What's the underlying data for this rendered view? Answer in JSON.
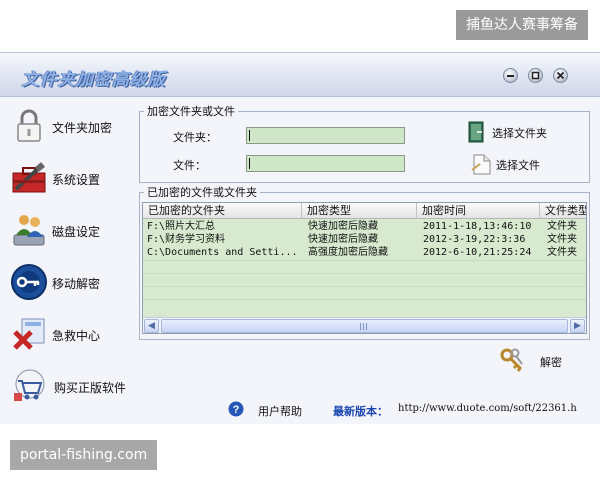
{
  "watermark_top": "捕鱼达人赛事筹备",
  "watermark_bottom": "portal-fishing.com",
  "window": {
    "title": "文件夹加密高级版",
    "controls": [
      "minimize-icon",
      "maximize-icon",
      "close-icon"
    ]
  },
  "sidebar": {
    "items": [
      {
        "label": "文件夹加密",
        "icon": "lock-icon"
      },
      {
        "label": "系统设置",
        "icon": "toolbox-icon"
      },
      {
        "label": "磁盘设定",
        "icon": "users-disk-icon"
      },
      {
        "label": "移动解密",
        "icon": "key-disc-icon"
      },
      {
        "label": "急救中心",
        "icon": "first-aid-icon"
      },
      {
        "label": "购买正版软件",
        "icon": "shopping-cart-icon"
      }
    ]
  },
  "encrypt_group": {
    "legend": "加密文件夹或文件",
    "folder_label": "文件夹：",
    "file_label": "文件：",
    "folder_value": "",
    "file_value": "",
    "choose_folder": "选择文件夹",
    "choose_file": "选择文件"
  },
  "encrypted_group": {
    "legend": "已加密的文件或文件夹",
    "columns": [
      "已加密的文件夹",
      "加密类型",
      "加密时间",
      "文件类型"
    ],
    "rows": [
      [
        "F:\\照片大汇总",
        "快速加密后隐藏",
        "2011-1-18,13:46:10",
        "文件夹"
      ],
      [
        "F:\\财务学习资料",
        "快速加密后隐藏",
        "2012-3-19,22:3:36",
        "文件夹"
      ],
      [
        "C:\\Documents and Setti...",
        "高强度加密后隐藏",
        "2012-6-10,21:25:24",
        "文件夹"
      ]
    ]
  },
  "decrypt_label": "解密",
  "status": {
    "help": "用户帮助",
    "latest_label": "最新版本：",
    "latest_url": "http://www.duote.com/soft/22361.h"
  },
  "colors": {
    "input_bg": "#cfe6c8",
    "table_bg": "#d7eacf",
    "title_blue": "#8fb1e6",
    "link_blue": "#1b46b0"
  }
}
